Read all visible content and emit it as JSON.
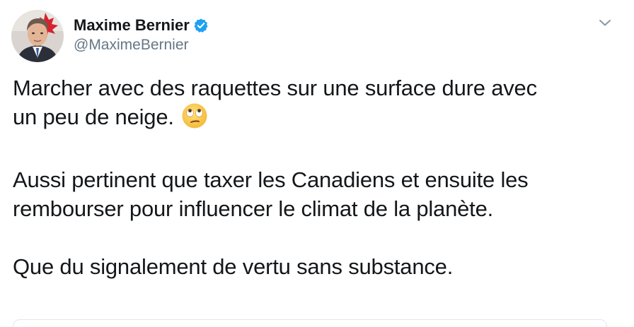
{
  "author": {
    "display_name": "Maxime Bernier",
    "handle": "@MaximeBernier",
    "verified": true,
    "avatar_icon": "profile-photo"
  },
  "icons": {
    "verified": "verified-badge-icon",
    "menu": "chevron-down-icon",
    "emoji": "face-with-rolling-eyes"
  },
  "tweet": {
    "paragraphs": [
      {
        "lines": [
          "Marcher avec des raquettes sur une surface dure avec",
          "un peu de neige."
        ],
        "emoji": "🙄"
      },
      {
        "lines": [
          "Aussi pertinent que taxer les Canadiens et ensuite les",
          "rembourser pour influencer le climat de la planète."
        ]
      },
      {
        "lines": [
          "Que du signalement de vertu sans substance."
        ]
      }
    ]
  },
  "colors": {
    "text": "#14171a",
    "secondary": "#657786",
    "verified_blue": "#1da1f2",
    "divider": "#e1e8ed"
  }
}
